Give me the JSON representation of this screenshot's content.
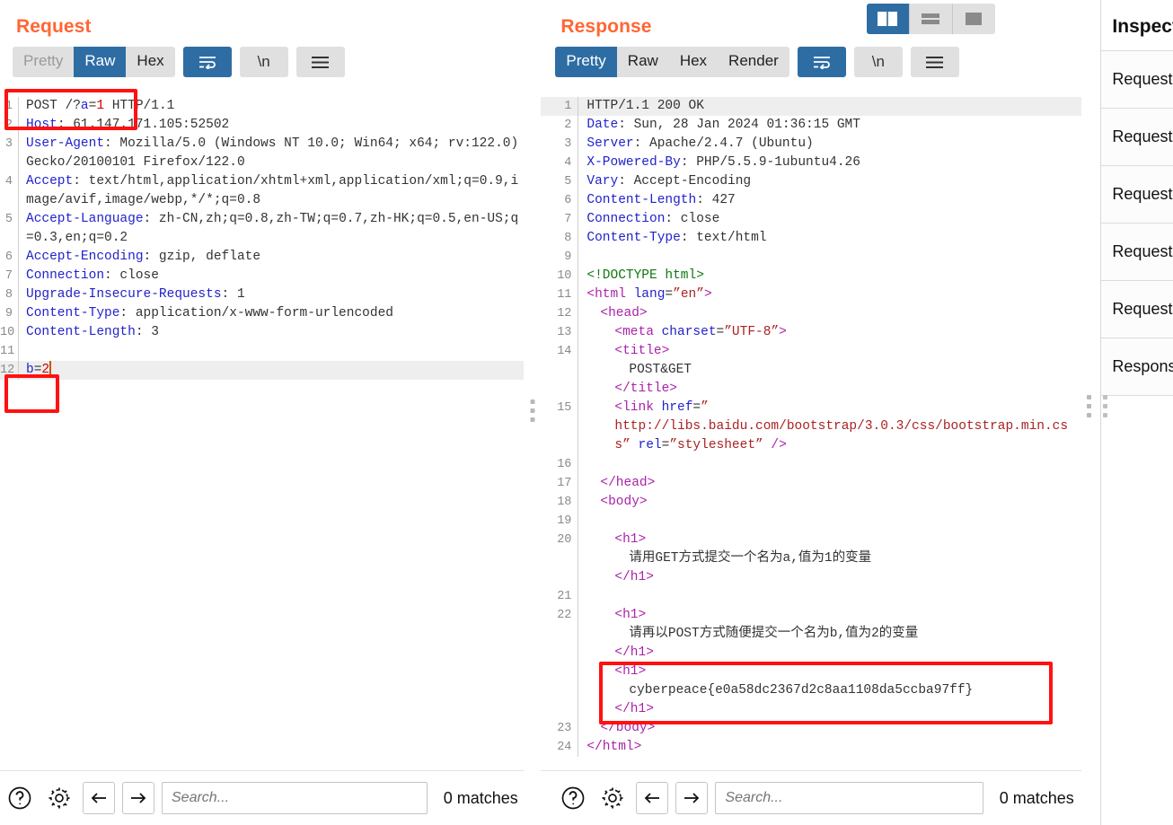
{
  "view_modes": [
    {
      "name": "side-by-side",
      "active": true
    },
    {
      "name": "stacked",
      "active": false
    },
    {
      "name": "single",
      "active": false
    }
  ],
  "request": {
    "title": "Request",
    "tabs": [
      {
        "label": "Pretty",
        "active": false,
        "muted": true
      },
      {
        "label": "Raw",
        "active": true,
        "muted": false
      },
      {
        "label": "Hex",
        "active": false,
        "muted": false
      }
    ],
    "wrap_button": "word-wrap-icon",
    "newline_button": "\\n",
    "menu_button": "hamburger-icon",
    "lines": [
      {
        "n": "1",
        "highlight": false,
        "segments": [
          {
            "t": "POST /?",
            "c": "plain"
          },
          {
            "t": "a",
            "c": "blue"
          },
          {
            "t": "=",
            "c": "plain"
          },
          {
            "t": "1",
            "c": "num"
          },
          {
            "t": " HTTP/1.1",
            "c": "plain"
          }
        ]
      },
      {
        "n": "2",
        "highlight": false,
        "segments": [
          {
            "t": "Host",
            "c": "k"
          },
          {
            "t": ": 61.147.171.105:52502",
            "c": "plain"
          }
        ]
      },
      {
        "n": "3",
        "highlight": false,
        "segments": [
          {
            "t": "User-Agent",
            "c": "k"
          },
          {
            "t": ": Mozilla/5.0 (Windows NT 10.0; Win64; x64; rv:122.0) Gecko/20100101 Firefox/122.0",
            "c": "plain"
          }
        ]
      },
      {
        "n": "4",
        "highlight": false,
        "segments": [
          {
            "t": "Accept",
            "c": "k"
          },
          {
            "t": ": text/html,application/xhtml+xml,application/xml;q=0.9,image/avif,image/webp,*/*;q=0.8",
            "c": "plain"
          }
        ]
      },
      {
        "n": "5",
        "highlight": false,
        "segments": [
          {
            "t": "Accept-Language",
            "c": "k"
          },
          {
            "t": ": zh-CN,zh;q=0.8,zh-TW;q=0.7,zh-HK;q=0.5,en-US;q=0.3,en;q=0.2",
            "c": "plain"
          }
        ]
      },
      {
        "n": "6",
        "highlight": false,
        "segments": [
          {
            "t": "Accept-Encoding",
            "c": "k"
          },
          {
            "t": ": gzip, deflate",
            "c": "plain"
          }
        ]
      },
      {
        "n": "7",
        "highlight": false,
        "segments": [
          {
            "t": "Connection",
            "c": "k"
          },
          {
            "t": ": close",
            "c": "plain"
          }
        ]
      },
      {
        "n": "8",
        "highlight": false,
        "segments": [
          {
            "t": "Upgrade-Insecure-Requests",
            "c": "k"
          },
          {
            "t": ": 1",
            "c": "plain"
          }
        ]
      },
      {
        "n": "9",
        "highlight": false,
        "segments": [
          {
            "t": "Content-Type",
            "c": "k"
          },
          {
            "t": ": application/x-www-form-urlencoded",
            "c": "plain"
          }
        ]
      },
      {
        "n": "10",
        "highlight": false,
        "segments": [
          {
            "t": "Content-Length",
            "c": "k"
          },
          {
            "t": ": 3",
            "c": "plain"
          }
        ]
      },
      {
        "n": "11",
        "highlight": false,
        "segments": []
      },
      {
        "n": "12",
        "highlight": true,
        "segments": [
          {
            "t": "b",
            "c": "blue"
          },
          {
            "t": "=",
            "c": "plain"
          },
          {
            "t": "2",
            "c": "num"
          }
        ],
        "caret": true
      }
    ],
    "bottom": {
      "help_icon": "question-mark-icon",
      "settings_icon": "gear-icon",
      "prev_icon": "arrow-left-icon",
      "next_icon": "arrow-right-icon",
      "search_placeholder": "Search...",
      "search_value": "",
      "matches": "0 matches"
    }
  },
  "response": {
    "title": "Response",
    "tabs": [
      {
        "label": "Pretty",
        "active": true,
        "muted": false
      },
      {
        "label": "Raw",
        "active": false,
        "muted": false
      },
      {
        "label": "Hex",
        "active": false,
        "muted": false
      },
      {
        "label": "Render",
        "active": false,
        "muted": false
      }
    ],
    "wrap_button": "word-wrap-icon",
    "newline_button": "\\n",
    "menu_button": "hamburger-icon",
    "lines": [
      {
        "n": "1",
        "highlight": true,
        "segments": [
          {
            "t": "HTTP/1.1 200 OK",
            "c": "plain"
          }
        ]
      },
      {
        "n": "2",
        "highlight": false,
        "segments": [
          {
            "t": "Date",
            "c": "k"
          },
          {
            "t": ": Sun, 28 Jan 2024 01:36:15 GMT",
            "c": "plain"
          }
        ]
      },
      {
        "n": "3",
        "highlight": false,
        "segments": [
          {
            "t": "Server",
            "c": "k"
          },
          {
            "t": ": Apache/2.4.7 (Ubuntu)",
            "c": "plain"
          }
        ]
      },
      {
        "n": "4",
        "highlight": false,
        "segments": [
          {
            "t": "X-Powered-By",
            "c": "k"
          },
          {
            "t": ": PHP/5.5.9-1ubuntu4.26",
            "c": "plain"
          }
        ]
      },
      {
        "n": "5",
        "highlight": false,
        "segments": [
          {
            "t": "Vary",
            "c": "k"
          },
          {
            "t": ": Accept-Encoding",
            "c": "plain"
          }
        ]
      },
      {
        "n": "6",
        "highlight": false,
        "segments": [
          {
            "t": "Content-Length",
            "c": "k"
          },
          {
            "t": ": 427",
            "c": "plain"
          }
        ]
      },
      {
        "n": "7",
        "highlight": false,
        "segments": [
          {
            "t": "Connection",
            "c": "k"
          },
          {
            "t": ": close",
            "c": "plain"
          }
        ]
      },
      {
        "n": "8",
        "highlight": false,
        "segments": [
          {
            "t": "Content-Type",
            "c": "k"
          },
          {
            "t": ": text/html",
            "c": "plain"
          }
        ]
      },
      {
        "n": "9",
        "highlight": false,
        "segments": []
      },
      {
        "n": "10",
        "highlight": false,
        "segments": [
          {
            "t": "<!DOCTYPE html>",
            "c": "doctype"
          }
        ]
      },
      {
        "n": "11",
        "highlight": false,
        "segments": [
          {
            "t": "<html ",
            "c": "tag"
          },
          {
            "t": "lang",
            "c": "attr"
          },
          {
            "t": "=",
            "c": "plain"
          },
          {
            "t": "”en”",
            "c": "str"
          },
          {
            "t": ">",
            "c": "tag"
          }
        ]
      },
      {
        "n": "12",
        "highlight": false,
        "indent": 1,
        "segments": [
          {
            "t": "<head>",
            "c": "tag"
          }
        ]
      },
      {
        "n": "13",
        "highlight": false,
        "indent": 2,
        "segments": [
          {
            "t": "<meta ",
            "c": "tag"
          },
          {
            "t": "charset",
            "c": "attr"
          },
          {
            "t": "=",
            "c": "plain"
          },
          {
            "t": "”UTF-8”",
            "c": "str"
          },
          {
            "t": ">",
            "c": "tag"
          }
        ]
      },
      {
        "n": "14",
        "highlight": false,
        "indent": 2,
        "segments": [
          {
            "t": "<title>",
            "c": "tag"
          }
        ]
      },
      {
        "n": "",
        "highlight": false,
        "indent": 3,
        "segments": [
          {
            "t": "POST&GET",
            "c": "plain"
          }
        ]
      },
      {
        "n": "",
        "highlight": false,
        "indent": 2,
        "segments": [
          {
            "t": "</title>",
            "c": "tag"
          }
        ]
      },
      {
        "n": "15",
        "highlight": false,
        "indent": 2,
        "segments": [
          {
            "t": "<link ",
            "c": "tag"
          },
          {
            "t": "href",
            "c": "attr"
          },
          {
            "t": "=",
            "c": "plain"
          },
          {
            "t": "”",
            "c": "str"
          }
        ]
      },
      {
        "n": "",
        "highlight": false,
        "indent": 2,
        "segments": [
          {
            "t": "http://libs.baidu.com/bootstrap/3.0.3/css/bootstrap.min.css” ",
            "c": "str"
          },
          {
            "t": "rel",
            "c": "attr"
          },
          {
            "t": "=",
            "c": "plain"
          },
          {
            "t": "”stylesheet”",
            "c": "str"
          },
          {
            "t": " />",
            "c": "tag"
          }
        ]
      },
      {
        "n": "16",
        "highlight": false,
        "segments": []
      },
      {
        "n": "17",
        "highlight": false,
        "indent": 1,
        "segments": [
          {
            "t": "</head>",
            "c": "tag"
          }
        ]
      },
      {
        "n": "18",
        "highlight": false,
        "indent": 1,
        "segments": [
          {
            "t": "<body>",
            "c": "tag"
          }
        ]
      },
      {
        "n": "19",
        "highlight": false,
        "segments": []
      },
      {
        "n": "20",
        "highlight": false,
        "indent": 2,
        "segments": [
          {
            "t": "<h1>",
            "c": "tag"
          }
        ]
      },
      {
        "n": "",
        "highlight": false,
        "indent": 3,
        "segments": [
          {
            "t": "请用GET方式提交一个名为a,值为1的变量",
            "c": "plain"
          }
        ]
      },
      {
        "n": "",
        "highlight": false,
        "indent": 2,
        "segments": [
          {
            "t": "</h1>",
            "c": "tag"
          }
        ]
      },
      {
        "n": "21",
        "highlight": false,
        "segments": []
      },
      {
        "n": "22",
        "highlight": false,
        "indent": 2,
        "segments": [
          {
            "t": "<h1>",
            "c": "tag"
          }
        ]
      },
      {
        "n": "",
        "highlight": false,
        "indent": 3,
        "segments": [
          {
            "t": "请再以POST方式随便提交一个名为b,值为2的变量",
            "c": "plain"
          }
        ]
      },
      {
        "n": "",
        "highlight": false,
        "indent": 2,
        "segments": [
          {
            "t": "</h1>",
            "c": "tag"
          }
        ]
      },
      {
        "n": "",
        "highlight": false,
        "indent": 2,
        "segments": [
          {
            "t": "<h1>",
            "c": "tag"
          }
        ]
      },
      {
        "n": "",
        "highlight": false,
        "indent": 3,
        "segments": [
          {
            "t": "cyberpeace{e0a58dc2367d2c8aa1108da5ccba97ff}",
            "c": "plain"
          }
        ]
      },
      {
        "n": "",
        "highlight": false,
        "indent": 2,
        "segments": [
          {
            "t": "</h1>",
            "c": "tag"
          }
        ]
      },
      {
        "n": "23",
        "highlight": false,
        "indent": 1,
        "segments": [
          {
            "t": "</body>",
            "c": "tag"
          }
        ]
      },
      {
        "n": "24",
        "highlight": false,
        "segments": [
          {
            "t": "</html>",
            "c": "tag"
          }
        ]
      }
    ],
    "bottom": {
      "help_icon": "question-mark-icon",
      "settings_icon": "gear-icon",
      "prev_icon": "arrow-left-icon",
      "next_icon": "arrow-right-icon",
      "search_placeholder": "Search...",
      "search_value": "",
      "matches": "0 matches"
    }
  },
  "inspector": {
    "title": "Inspector",
    "rows": [
      {
        "label": "Request attributes"
      },
      {
        "label": "Request query parameters"
      },
      {
        "label": "Request body parameters"
      },
      {
        "label": "Request cookies"
      },
      {
        "label": "Request headers"
      },
      {
        "label": "Response headers"
      }
    ]
  },
  "annotations": [
    {
      "name": "request-line-highlight",
      "color": "#ff1111"
    },
    {
      "name": "request-body-highlight",
      "color": "#ff1111"
    },
    {
      "name": "flag-highlight",
      "color": "#ff1111"
    }
  ],
  "colors": {
    "accent_orange": "#ff6633",
    "active_blue": "#2e6da4",
    "annotation_red": "#ff1111"
  }
}
